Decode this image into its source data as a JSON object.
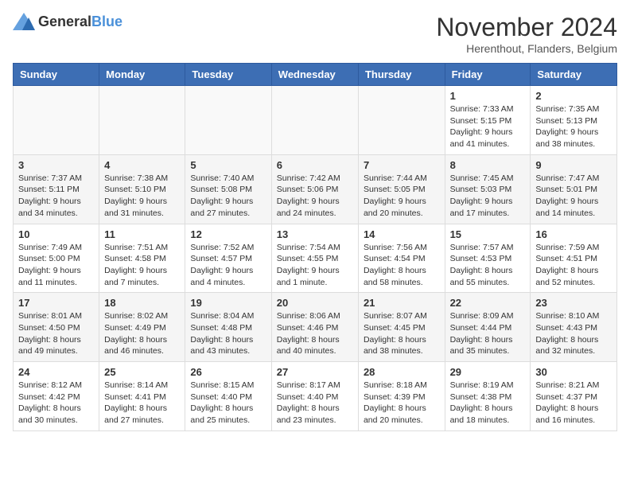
{
  "header": {
    "logo_general": "General",
    "logo_blue": "Blue",
    "month": "November 2024",
    "location": "Herenthout, Flanders, Belgium"
  },
  "days_of_week": [
    "Sunday",
    "Monday",
    "Tuesday",
    "Wednesday",
    "Thursday",
    "Friday",
    "Saturday"
  ],
  "weeks": [
    {
      "days": [
        {
          "num": "",
          "info": ""
        },
        {
          "num": "",
          "info": ""
        },
        {
          "num": "",
          "info": ""
        },
        {
          "num": "",
          "info": ""
        },
        {
          "num": "",
          "info": ""
        },
        {
          "num": "1",
          "info": "Sunrise: 7:33 AM\nSunset: 5:15 PM\nDaylight: 9 hours and 41 minutes."
        },
        {
          "num": "2",
          "info": "Sunrise: 7:35 AM\nSunset: 5:13 PM\nDaylight: 9 hours and 38 minutes."
        }
      ]
    },
    {
      "days": [
        {
          "num": "3",
          "info": "Sunrise: 7:37 AM\nSunset: 5:11 PM\nDaylight: 9 hours and 34 minutes."
        },
        {
          "num": "4",
          "info": "Sunrise: 7:38 AM\nSunset: 5:10 PM\nDaylight: 9 hours and 31 minutes."
        },
        {
          "num": "5",
          "info": "Sunrise: 7:40 AM\nSunset: 5:08 PM\nDaylight: 9 hours and 27 minutes."
        },
        {
          "num": "6",
          "info": "Sunrise: 7:42 AM\nSunset: 5:06 PM\nDaylight: 9 hours and 24 minutes."
        },
        {
          "num": "7",
          "info": "Sunrise: 7:44 AM\nSunset: 5:05 PM\nDaylight: 9 hours and 20 minutes."
        },
        {
          "num": "8",
          "info": "Sunrise: 7:45 AM\nSunset: 5:03 PM\nDaylight: 9 hours and 17 minutes."
        },
        {
          "num": "9",
          "info": "Sunrise: 7:47 AM\nSunset: 5:01 PM\nDaylight: 9 hours and 14 minutes."
        }
      ]
    },
    {
      "days": [
        {
          "num": "10",
          "info": "Sunrise: 7:49 AM\nSunset: 5:00 PM\nDaylight: 9 hours and 11 minutes."
        },
        {
          "num": "11",
          "info": "Sunrise: 7:51 AM\nSunset: 4:58 PM\nDaylight: 9 hours and 7 minutes."
        },
        {
          "num": "12",
          "info": "Sunrise: 7:52 AM\nSunset: 4:57 PM\nDaylight: 9 hours and 4 minutes."
        },
        {
          "num": "13",
          "info": "Sunrise: 7:54 AM\nSunset: 4:55 PM\nDaylight: 9 hours and 1 minute."
        },
        {
          "num": "14",
          "info": "Sunrise: 7:56 AM\nSunset: 4:54 PM\nDaylight: 8 hours and 58 minutes."
        },
        {
          "num": "15",
          "info": "Sunrise: 7:57 AM\nSunset: 4:53 PM\nDaylight: 8 hours and 55 minutes."
        },
        {
          "num": "16",
          "info": "Sunrise: 7:59 AM\nSunset: 4:51 PM\nDaylight: 8 hours and 52 minutes."
        }
      ]
    },
    {
      "days": [
        {
          "num": "17",
          "info": "Sunrise: 8:01 AM\nSunset: 4:50 PM\nDaylight: 8 hours and 49 minutes."
        },
        {
          "num": "18",
          "info": "Sunrise: 8:02 AM\nSunset: 4:49 PM\nDaylight: 8 hours and 46 minutes."
        },
        {
          "num": "19",
          "info": "Sunrise: 8:04 AM\nSunset: 4:48 PM\nDaylight: 8 hours and 43 minutes."
        },
        {
          "num": "20",
          "info": "Sunrise: 8:06 AM\nSunset: 4:46 PM\nDaylight: 8 hours and 40 minutes."
        },
        {
          "num": "21",
          "info": "Sunrise: 8:07 AM\nSunset: 4:45 PM\nDaylight: 8 hours and 38 minutes."
        },
        {
          "num": "22",
          "info": "Sunrise: 8:09 AM\nSunset: 4:44 PM\nDaylight: 8 hours and 35 minutes."
        },
        {
          "num": "23",
          "info": "Sunrise: 8:10 AM\nSunset: 4:43 PM\nDaylight: 8 hours and 32 minutes."
        }
      ]
    },
    {
      "days": [
        {
          "num": "24",
          "info": "Sunrise: 8:12 AM\nSunset: 4:42 PM\nDaylight: 8 hours and 30 minutes."
        },
        {
          "num": "25",
          "info": "Sunrise: 8:14 AM\nSunset: 4:41 PM\nDaylight: 8 hours and 27 minutes."
        },
        {
          "num": "26",
          "info": "Sunrise: 8:15 AM\nSunset: 4:40 PM\nDaylight: 8 hours and 25 minutes."
        },
        {
          "num": "27",
          "info": "Sunrise: 8:17 AM\nSunset: 4:40 PM\nDaylight: 8 hours and 23 minutes."
        },
        {
          "num": "28",
          "info": "Sunrise: 8:18 AM\nSunset: 4:39 PM\nDaylight: 8 hours and 20 minutes."
        },
        {
          "num": "29",
          "info": "Sunrise: 8:19 AM\nSunset: 4:38 PM\nDaylight: 8 hours and 18 minutes."
        },
        {
          "num": "30",
          "info": "Sunrise: 8:21 AM\nSunset: 4:37 PM\nDaylight: 8 hours and 16 minutes."
        }
      ]
    }
  ]
}
